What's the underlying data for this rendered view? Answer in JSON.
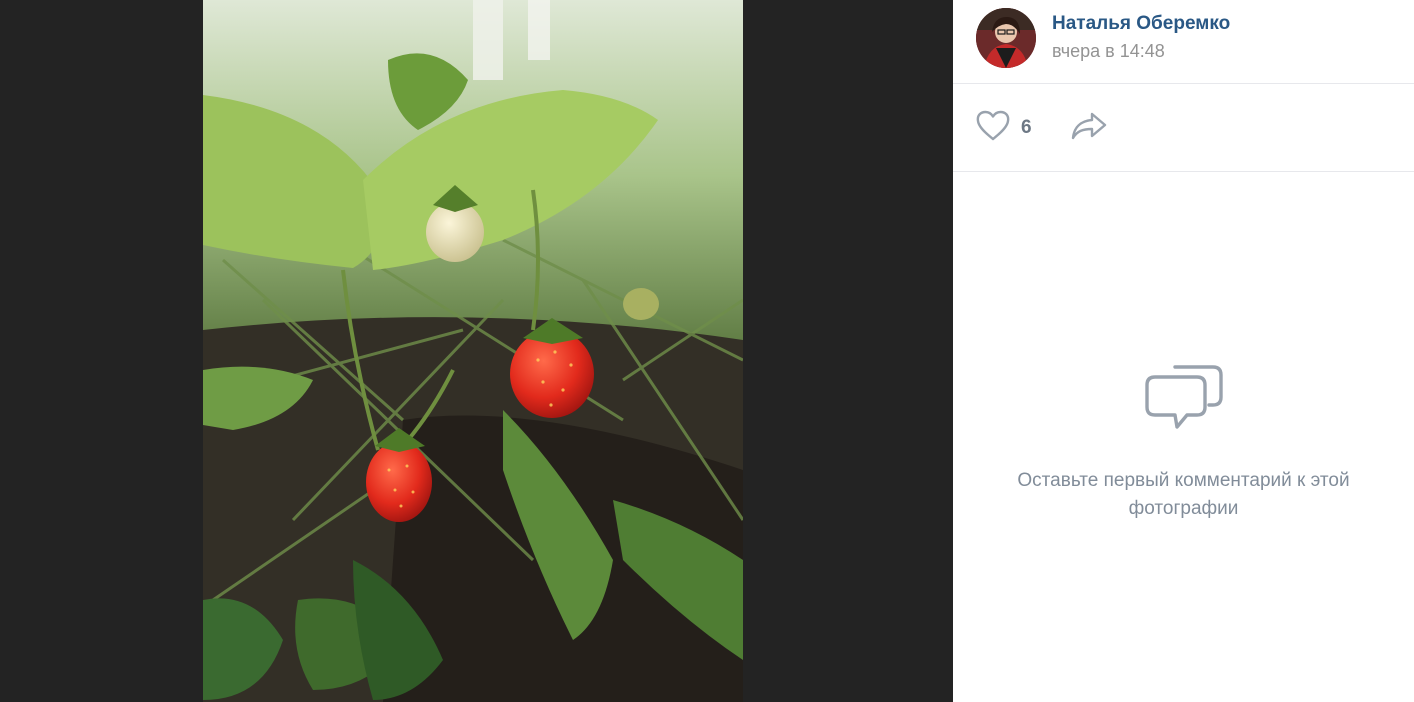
{
  "author": {
    "name": "Наталья Оберемко",
    "time": "вчера в 14:48"
  },
  "actions": {
    "likes": "6"
  },
  "comments": {
    "empty_text": "Оставьте первый комментарий к этой фотографии"
  },
  "icons": {
    "like": "heart-icon",
    "share": "share-arrow-icon",
    "empty_comments": "chat-bubbles-icon"
  },
  "colors": {
    "link": "#2a5885",
    "muted": "#939393",
    "icon": "#99a2ad",
    "viewer_bg": "#232323"
  }
}
